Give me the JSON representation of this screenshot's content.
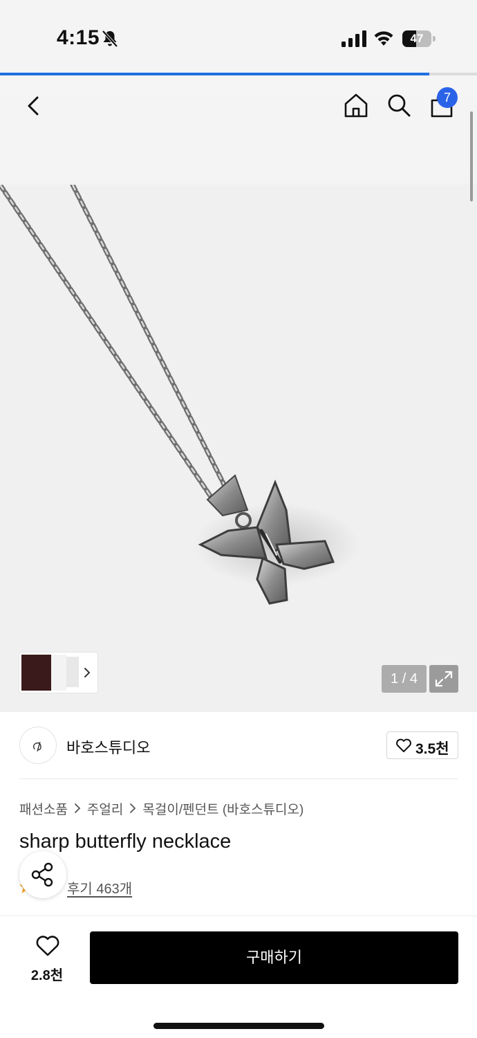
{
  "status_bar": {
    "time": "4:15",
    "battery_level": "47",
    "battery_fraction": 0.47,
    "icons": [
      "bell-slash-icon",
      "cellular-signal-icon",
      "wifi-icon",
      "battery-icon"
    ]
  },
  "page_load_progress": 0.9,
  "top_nav": {
    "icons": [
      "chevron-left-icon",
      "home-icon",
      "search-icon",
      "shopping-bag-icon"
    ],
    "cart_badge": "7",
    "accent_color": "#2b63e8"
  },
  "gallery": {
    "page_indicator": "1 / 4",
    "current_page": 1,
    "total_pages": 4,
    "icons": [
      "chevron-right-icon",
      "expand-icon"
    ]
  },
  "store": {
    "name": "바호스튜디오",
    "like_count": "3.5천"
  },
  "breadcrumb": {
    "items": [
      "패션소품",
      "주얼리",
      "목걸이/펜던트 (바호스튜디오)"
    ]
  },
  "product": {
    "title": "sharp butterfly necklace",
    "review_link": "후기 463개",
    "rating_star_color": "#f5a623"
  },
  "bottom_bar": {
    "wish_count": "2.8천",
    "buy_label": "구매하기"
  }
}
